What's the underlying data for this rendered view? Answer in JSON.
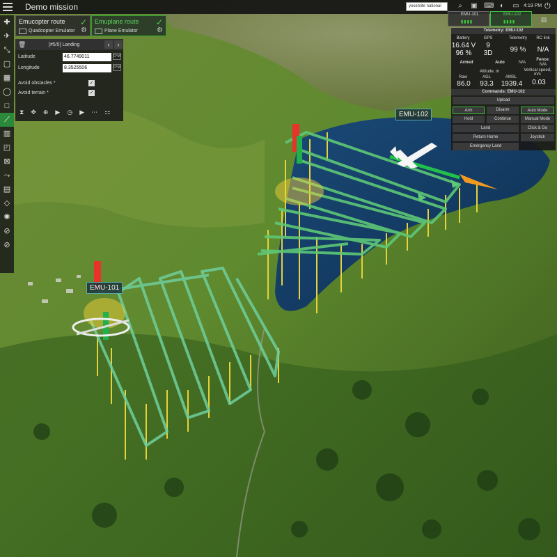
{
  "app": {
    "title": "Demo mission"
  },
  "search": {
    "value": "yosemite national"
  },
  "clock": "4:19 PM",
  "icons": {
    "menu": "hamburger-icon",
    "search": "search-icon",
    "camera": "camera-icon",
    "keyboard": "keyboard-icon",
    "headset": "headset-icon",
    "battery": "battery-icon",
    "power": "power-icon"
  },
  "routes": [
    {
      "name": "Emucopter route",
      "vehicle": "Quadcopter Emulator",
      "active": false
    },
    {
      "name": "Emuplane route",
      "vehicle": "Plane Emulator",
      "active": true
    }
  ],
  "waypoint": {
    "header": "[#5/5] Landing",
    "latitude_label": "Latitude",
    "latitude": "46.7749011",
    "longitude_label": "Longitude",
    "longitude": "8.3525506",
    "unit": "D°M'",
    "avoid_obstacles": "Avoid obstacles *",
    "avoid_terrain": "Avoid terrain *"
  },
  "vehicles": [
    {
      "name": "EMU-101",
      "active": false
    },
    {
      "name": "EMU-102",
      "active": true
    }
  ],
  "telemetry": {
    "header": "Telemetry: EMU-102",
    "battery_label": "Battery",
    "battery_v": "16.64 V",
    "battery_pct": "96 %",
    "gps_label": "GPS",
    "gps_sats": "9",
    "gps_fix": "3D",
    "telemetry_label": "Telemetry",
    "telemetry_pct": "99 %",
    "rclink_label": "RC link",
    "rclink_val": "N/A",
    "armed": "Armed",
    "mode": "Auto",
    "na": "N/A",
    "fence_label": "Fence:",
    "fence_val": "N/A",
    "altitude_label": "Altitude, m",
    "vspeed_label": "Vertical speed, m/s",
    "raw_label": "Raw",
    "agl_label": "AGL",
    "amsl_label": "AMSL",
    "raw": "86.0",
    "agl": "93.3",
    "amsl": "1939.4",
    "vspeed": "0.03"
  },
  "commands": {
    "header": "Commands: EMU-102",
    "upload": "Upload",
    "arm": "Arm",
    "disarm": "Disarm",
    "auto_mode": "Auto Mode",
    "hold": "Hold",
    "continue": "Continue",
    "manual_mode": "Manual Mode",
    "land": "Land",
    "click_go": "Click & Go",
    "return_home": "Return Home",
    "joystick": "Joystick",
    "emergency_land": "Emergency Land"
  },
  "map_labels": {
    "emu102": "EMU-102",
    "emu101": "EMU-101"
  }
}
